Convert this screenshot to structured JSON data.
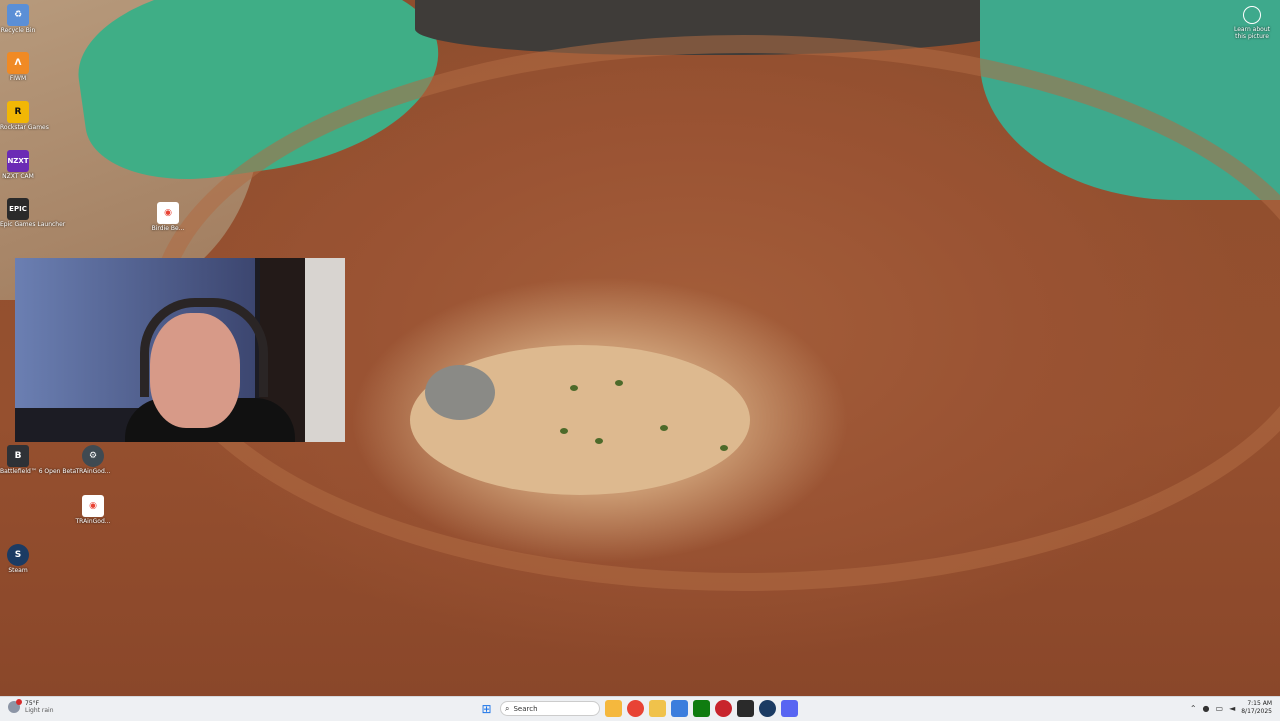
{
  "desktop_icons": [
    {
      "label": "Recycle Bin",
      "icon": "recycle-bin-icon",
      "color": "#5b8fd6"
    },
    {
      "label": "FIWM",
      "icon": "fiwm-app-icon",
      "color": "#f08a24"
    },
    {
      "label": "Rockstar Games",
      "icon": "rockstar-games-icon",
      "color": "#f2b705"
    },
    {
      "label": "NZXT CAM",
      "icon": "nzxt-cam-icon",
      "color": "#6b2bb5"
    },
    {
      "label": "Epic Games Launcher",
      "icon": "epic-games-icon",
      "color": "#2a2a2a"
    },
    {
      "label": "Battlefield™ 6 Open Beta",
      "icon": "battlefield-icon",
      "color": "#2e3136"
    },
    {
      "label": "TRAinGod...",
      "icon": "traingod-app-icon",
      "color": "#3f4a52"
    },
    {
      "label": "TRAinGod...",
      "icon": "chrome-shortcut-icon",
      "color": "#ffffff"
    },
    {
      "label": "Steam",
      "icon": "steam-icon",
      "color": "#1b3b63"
    },
    {
      "label": "Birdie Be...",
      "icon": "chrome-shortcut-icon",
      "color": "#ffffff"
    }
  ],
  "learn_about": {
    "label": "Learn about this picture"
  },
  "taskbar": {
    "weather_temp": "75°F",
    "weather_desc": "Light rain",
    "search_placeholder": "Search",
    "time": "7:15 AM",
    "date": "8/17/2025",
    "apps": [
      {
        "name": "file-explorer-icon",
        "color": "#f5b83d"
      },
      {
        "name": "chrome-icon",
        "color": "#e84335"
      },
      {
        "name": "folder-icon",
        "color": "#f0c24b"
      },
      {
        "name": "photos-icon",
        "color": "#3b7ddd"
      },
      {
        "name": "xbox-icon",
        "color": "#107c10"
      },
      {
        "name": "app-red-icon",
        "color": "#c8242c"
      },
      {
        "name": "epic-games-icon",
        "color": "#2a2a2a"
      },
      {
        "name": "steam-icon",
        "color": "#1b3b63"
      },
      {
        "name": "discord-icon",
        "color": "#5865f2"
      }
    ]
  }
}
